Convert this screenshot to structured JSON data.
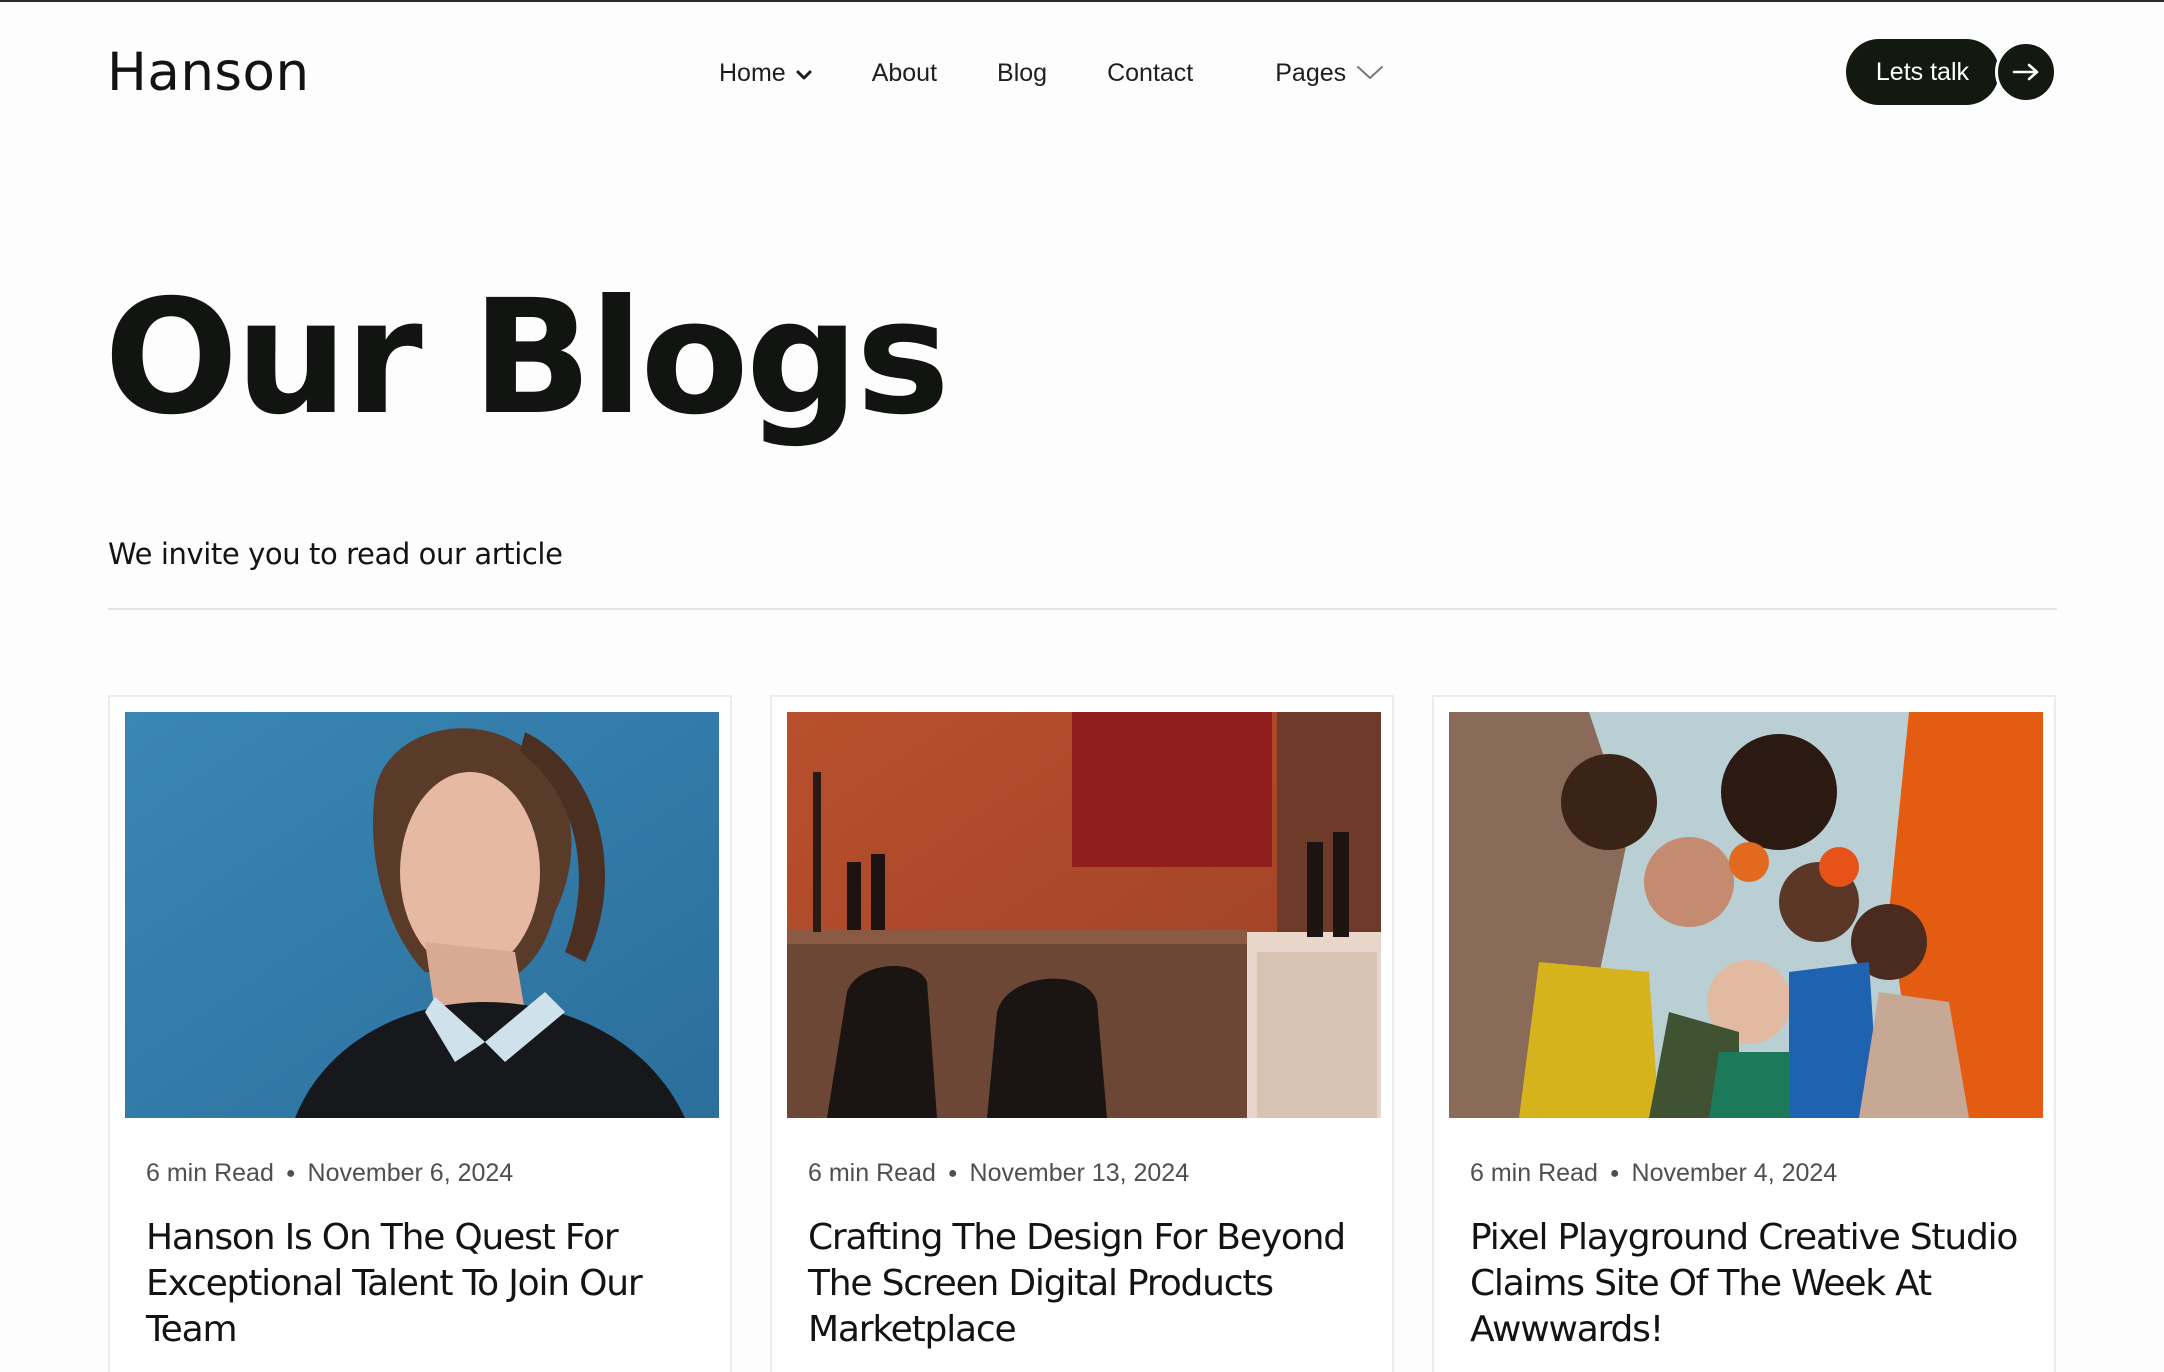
{
  "header": {
    "logo": "Hanson",
    "nav": [
      {
        "label": "Home",
        "has_dropdown": true
      },
      {
        "label": "About",
        "has_dropdown": false
      },
      {
        "label": "Blog",
        "has_dropdown": false
      },
      {
        "label": "Contact",
        "has_dropdown": false
      },
      {
        "label": "Pages",
        "has_dropdown": true
      }
    ],
    "cta_label": "Lets talk",
    "cta_icon": "arrow-right-icon"
  },
  "hero": {
    "title": "Our Blogs",
    "subtitle": "We invite you to read our article"
  },
  "posts": [
    {
      "read_time": "6 min Read",
      "date": "November 6, 2024",
      "title": "Hanson Is On The Quest For Exceptional Talent To Join Our Team",
      "image": "portrait-woman-blue-background"
    },
    {
      "read_time": "6 min Read",
      "date": "November 13, 2024",
      "title": "Crafting The Design For Beyond The Screen Digital Products Marketplace",
      "image": "orange-interior-bar-chairs"
    },
    {
      "read_time": "6 min Read",
      "date": "November 4, 2024",
      "title": "Pixel Playground Creative Studio Claims Site Of The Week At Awwwards!",
      "image": "group-low-angle-colorful"
    }
  ],
  "colors": {
    "background": "#fdfdfd",
    "text": "#111410",
    "button": "#131810",
    "divider": "#e6e6e6"
  }
}
